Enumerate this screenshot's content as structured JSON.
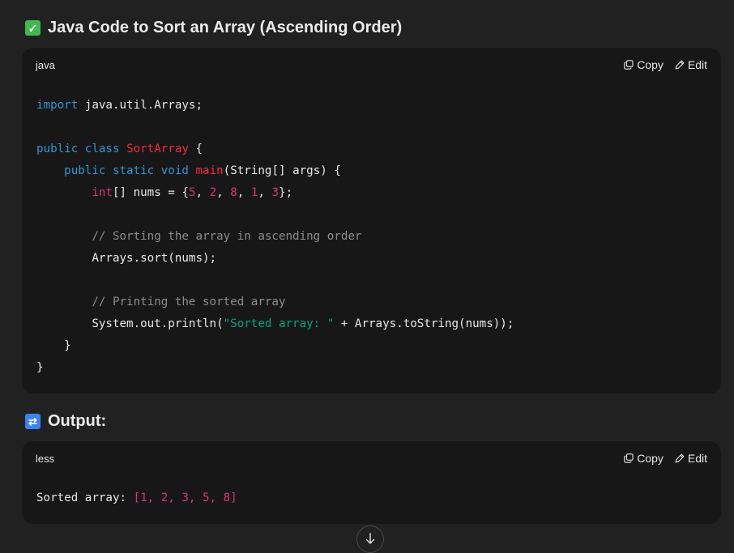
{
  "section1": {
    "title": "Java Code to Sort an Array (Ascending Order)",
    "icon": "check-mark-emoji",
    "block": {
      "language": "java",
      "copy_label": "Copy",
      "edit_label": "Edit",
      "lines": [
        [
          {
            "t": "import",
            "c": "kw"
          },
          {
            "t": " java.util.Arrays;"
          }
        ],
        [],
        [
          {
            "t": "public",
            "c": "kw"
          },
          {
            "t": " "
          },
          {
            "t": "class",
            "c": "kw"
          },
          {
            "t": " "
          },
          {
            "t": "SortArray",
            "c": "cls"
          },
          {
            "t": " {"
          }
        ],
        [
          {
            "t": "    "
          },
          {
            "t": "public",
            "c": "kw"
          },
          {
            "t": " "
          },
          {
            "t": "static",
            "c": "kw"
          },
          {
            "t": " "
          },
          {
            "t": "void",
            "c": "kw"
          },
          {
            "t": " "
          },
          {
            "t": "main",
            "c": "cls"
          },
          {
            "t": "(String[] args) {"
          }
        ],
        [
          {
            "t": "        "
          },
          {
            "t": "int",
            "c": "num"
          },
          {
            "t": "[] nums = {"
          },
          {
            "t": "5",
            "c": "num"
          },
          {
            "t": ", "
          },
          {
            "t": "2",
            "c": "num"
          },
          {
            "t": ", "
          },
          {
            "t": "8",
            "c": "num"
          },
          {
            "t": ", "
          },
          {
            "t": "1",
            "c": "num"
          },
          {
            "t": ", "
          },
          {
            "t": "3",
            "c": "num"
          },
          {
            "t": "};"
          }
        ],
        [],
        [
          {
            "t": "        "
          },
          {
            "t": "// Sorting the array in ascending order",
            "c": "cmt"
          }
        ],
        [
          {
            "t": "        Arrays.sort(nums);"
          }
        ],
        [],
        [
          {
            "t": "        "
          },
          {
            "t": "// Printing the sorted array",
            "c": "cmt"
          }
        ],
        [
          {
            "t": "        System.out.println("
          },
          {
            "t": "\"Sorted array: \"",
            "c": "str"
          },
          {
            "t": " + Arrays.toString(nums));"
          }
        ],
        [
          {
            "t": "    }"
          }
        ],
        [
          {
            "t": "}"
          }
        ]
      ]
    }
  },
  "section2": {
    "title": "Output:",
    "icon": "repeat-arrows-emoji",
    "block": {
      "language": "less",
      "copy_label": "Copy",
      "edit_label": "Edit",
      "lines": [
        [
          {
            "t": "Sorted array: "
          },
          {
            "t": "[1, 2, 3, 5, 8]",
            "c": "num"
          }
        ]
      ]
    }
  },
  "scroll_button": {
    "icon": "arrow-down-icon"
  }
}
